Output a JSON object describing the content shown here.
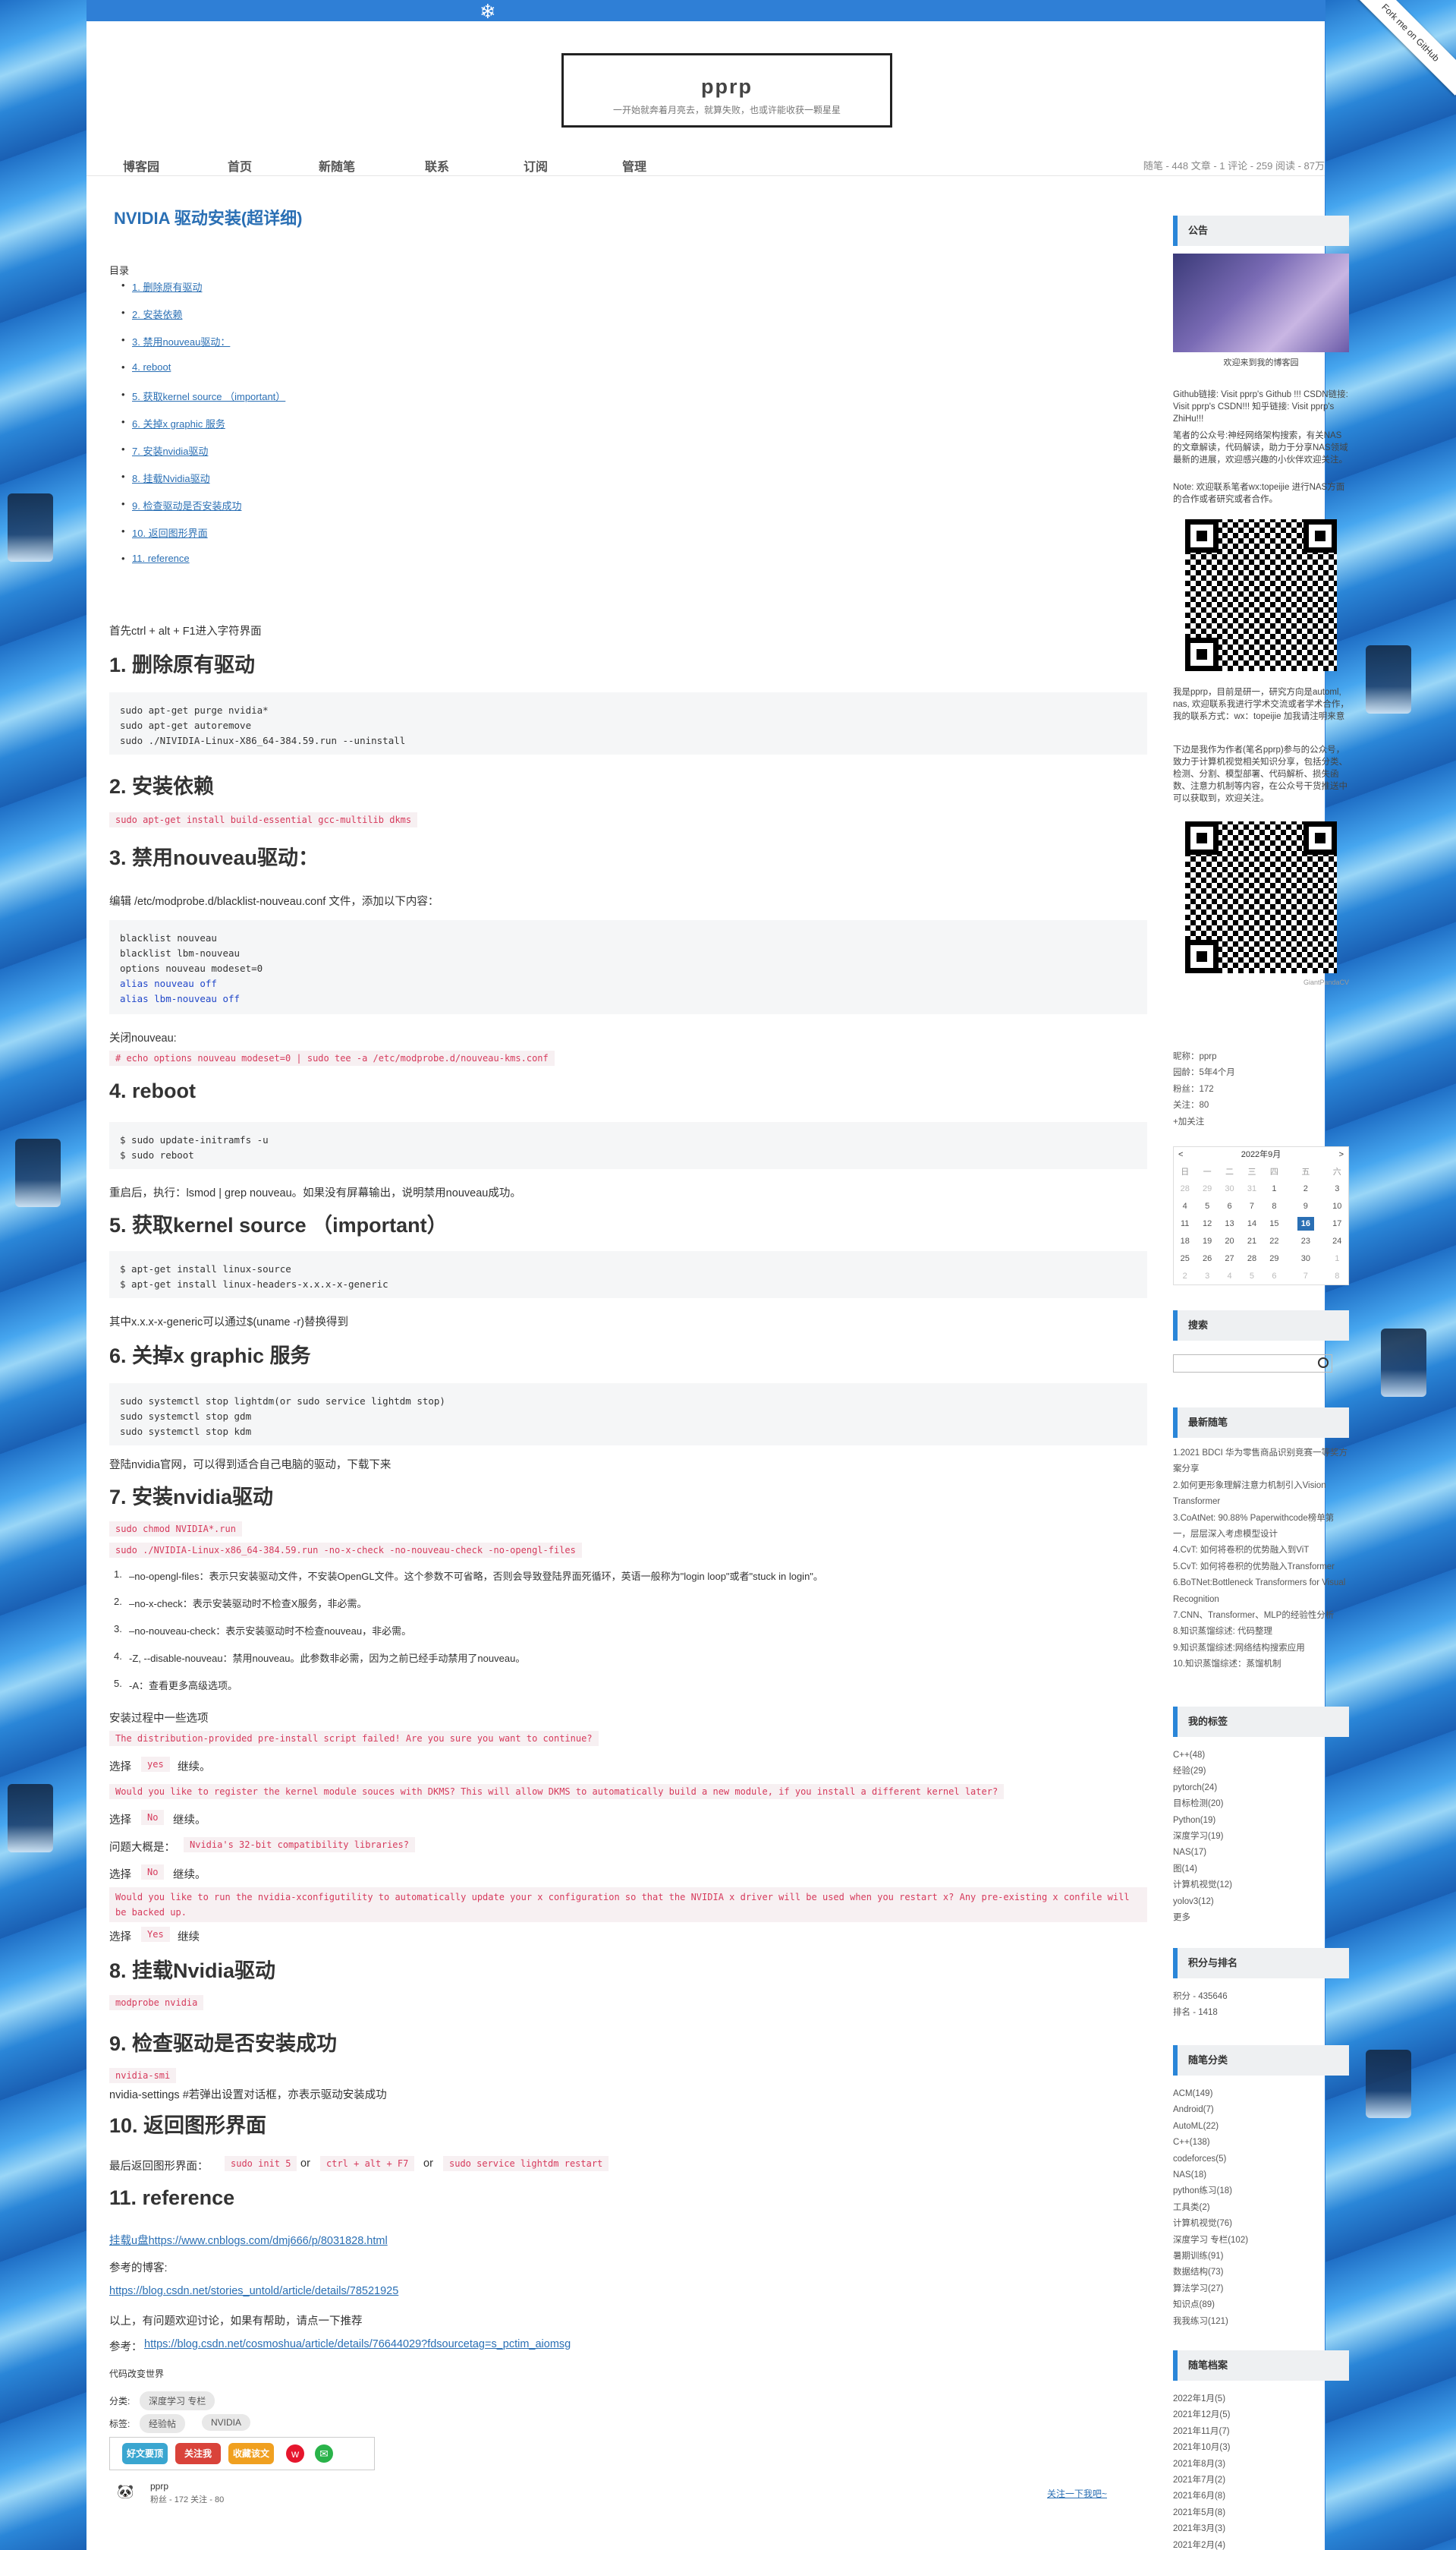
{
  "ribbon": "Fork me on GitHub",
  "header": {
    "title": "pprp",
    "subtitle": "一开始就奔着月亮去，就算失败，也或许能收获一颗星星"
  },
  "nav": [
    "博客园",
    "首页",
    "新随笔",
    "联系",
    "订阅",
    "管理"
  ],
  "blog_stats": "随笔 - 448  文章 - 1  评论 - 259  阅读 - 87万",
  "post": {
    "title": "NVIDIA 驱动安装(超详细)",
    "toc_label": "目录",
    "toc": [
      "1. 删除原有驱动",
      "2. 安装依赖",
      "3. 禁用nouveau驱动：",
      "4. reboot",
      "5. 获取kernel source （important）",
      "6. 关掉x graphic 服务",
      "7. 安装nvidia驱动",
      "8. 挂载Nvidia驱动",
      "9. 检查驱动是否安装成功",
      "10. 返回图形界面",
      "11. reference"
    ],
    "intro": "首先ctrl + alt + F1进入字符界面",
    "s1": {
      "title": "1. 删除原有驱动",
      "code": [
        "sudo apt-get purge nvidia*",
        "sudo apt-get autoremove",
        "sudo ./NIVIDIA-Linux-X86_64-384.59.run --uninstall"
      ]
    },
    "s2": {
      "title": "2. 安装依赖",
      "inline": "sudo apt-get install build-essential gcc-multilib dkms"
    },
    "s3": {
      "title": "3. 禁用nouveau驱动：",
      "text": "编辑 /etc/modprobe.d/blacklist-nouveau.conf 文件，添加以下内容：",
      "code": [
        "blacklist nouveau",
        "blacklist lbm-nouveau",
        "options nouveau modeset=0",
        "alias nouveau off",
        "alias lbm-nouveau off"
      ],
      "close_label": "关闭nouveau:",
      "inline": "# echo options nouveau modeset=0 | sudo tee -a /etc/modprobe.d/nouveau-kms.conf"
    },
    "s4": {
      "title": "4. reboot",
      "code": [
        "$ sudo update-initramfs -u",
        "$ sudo reboot"
      ],
      "text": "重启后，执行：lsmod | grep nouveau。如果没有屏幕输出，说明禁用nouveau成功。"
    },
    "s5": {
      "title": "5. 获取kernel source （important）",
      "code": [
        "$ apt-get install linux-source",
        "$ apt-get install linux-headers-x.x.x-x-generic"
      ],
      "text": "其中x.x.x-x-generic可以通过$(uname -r)替换得到"
    },
    "s6": {
      "title": "6. 关掉x graphic 服务",
      "code": [
        "sudo systemctl stop lightdm(or sudo service lightdm stop)",
        "sudo systemctl stop gdm",
        "sudo systemctl stop kdm"
      ],
      "text": "登陆nvidia官网，可以得到适合自己电脑的驱动，下载下来"
    },
    "s7": {
      "title": "7. 安装nvidia驱动",
      "inline1": "sudo chmod NVIDIA*.run",
      "inline2": "sudo ./NVIDIA-Linux-x86_64-384.59.run -no-x-check -no-nouveau-check -no-opengl-files",
      "options": [
        "–no-opengl-files：表示只安装驱动文件，不安装OpenGL文件。这个参数不可省略，否则会导致登陆界面死循环，英语一般称为\"login loop\"或者\"stuck in login\"。",
        "–no-x-check：表示安装驱动时不检查X服务，非必需。",
        "–no-nouveau-check：表示安装驱动时不检查nouveau，非必需。",
        "-Z, --disable-nouveau：禁用nouveau。此参数非必需，因为之前已经手动禁用了nouveau。",
        "-A：查看更多高级选项。"
      ],
      "process_label": "安装过程中一些选项",
      "q1": "The distribution-provided pre-install script failed! Are you sure you want to continue?",
      "choose": "选择",
      "continue": "继续。",
      "a1": "yes",
      "q2": "Would you like to register the kernel module souces with DKMS? This will allow DKMS to automatically build a new module, if you install a different kernel later?",
      "a2": "No",
      "q3_label": "问题大概是：",
      "q3": "Nvidia's 32-bit compatibility libraries?",
      "a3": "No",
      "q4": "Would you like to run the nvidia-xconfigutility to automatically update your x configuration so that the NVIDIA x driver will be used when you restart x? Any pre-existing x confile will be backed up.",
      "a4": "Yes",
      "continue2": "继续"
    },
    "s8": {
      "title": "8. 挂载Nvidia驱动",
      "inline": "modprobe nvidia"
    },
    "s9": {
      "title": "9. 检查驱动是否安装成功",
      "inline": "nvidia-smi",
      "text": "nvidia-settings #若弹出设置对话框，亦表示驱动安装成功"
    },
    "s10": {
      "title": "10. 返回图形界面",
      "label": "最后返回图形界面：",
      "c1": "sudo init 5",
      "or": "or",
      "c2": "ctrl + alt + F7",
      "c3": "sudo service lightdm restart"
    },
    "s11": {
      "title": "11. reference",
      "link1": "挂载u盘https://www.cnblogs.com/dmj666/p/8031828.html",
      "ref_label": "参考的博客:",
      "link2": "https://blog.csdn.net/stories_untold/article/details/78521925",
      "thanks": "以上，有问题欢迎讨论，如果有帮助，请点一下推荐",
      "ref2_label": "参考：",
      "link3": "https://blog.csdn.net/cosmoshua/article/details/76644029?fdsourcetag=s_pctim_aiomsg"
    },
    "signature": "代码改变世界",
    "category_label": "分类:",
    "category": "深度学习 专栏",
    "tags_label": "标签:",
    "tags": [
      "经验帖",
      "NVIDIA"
    ],
    "share": [
      "好文要顶",
      "关注我",
      "收藏该文"
    ],
    "author_name": "pprp",
    "author_stats": "粉丝 - 172  关注 - 80",
    "follow_link": "关注一下我吧~"
  },
  "sidebar": {
    "notice_title": "公告",
    "welcome": "欢迎来到我的博客园",
    "links_text": "Github链接: Visit pprp's Github !!! CSDN链接: Visit pprp's CSDN!!! 知乎链接: Visit pprp's ZhiHu!!!",
    "gzh_text": "笔者的公众号:神经网络架构搜索，有关NAS的文章解读，代码解读，助力于分享NAS领域最新的进展，欢迎感兴趣的小伙伴欢迎关注。",
    "note": "Note: 欢迎联系笔者wx:topeijie 进行NAS方面的合作或者研究或者合作。",
    "self_intro": "我是pprp，目前是研一，研究方向是automl, nas, 欢迎联系我进行学术交流或者学术合作，我的联系方式：wx：topeijie 加我请注明来意",
    "gdut_text": "下边是我作为作者(笔名pprp)参与的公众号，致力于计算机视觉相关知识分享，包括分类、检测、分割、模型部署、代码解析、损失函数、注意力机制等内容，在公众号干货推送中可以获取到，欢迎关注。",
    "qr_caption": "GiantPandaCV",
    "profile": [
      "昵称：pprp",
      "园龄：5年4个月",
      "粉丝：172",
      "关注：80",
      "+加关注"
    ],
    "calendar": {
      "title": "2022年9月",
      "prev": "<",
      "next": ">",
      "weekdays": [
        "日",
        "一",
        "二",
        "三",
        "四",
        "五",
        "六"
      ],
      "rows": [
        [
          "28",
          "29",
          "30",
          "31",
          "1",
          "2",
          "3"
        ],
        [
          "4",
          "5",
          "6",
          "7",
          "8",
          "9",
          "10"
        ],
        [
          "11",
          "12",
          "13",
          "14",
          "15",
          "16",
          "17"
        ],
        [
          "18",
          "19",
          "20",
          "21",
          "22",
          "23",
          "24"
        ],
        [
          "25",
          "26",
          "27",
          "28",
          "29",
          "30",
          "1"
        ],
        [
          "2",
          "3",
          "4",
          "5",
          "6",
          "7",
          "8"
        ]
      ],
      "today": "16"
    },
    "search_title": "搜索",
    "recent_title": "最新随笔",
    "recent": [
      "1.2021 BDCI 华为零售商品识别竞赛一等奖方案分享",
      "2.如何更形象理解注意力机制引入Vision Transformer",
      "3.CoAtNet: 90.88% Paperwithcode榜单第一，层层深入考虑模型设计",
      "4.CvT: 如何将卷积的优势融入到ViT",
      "5.CvT: 如何将卷积的优势融入Transformer",
      "6.BoTNet:Bottleneck Transformers for Visual Recognition",
      "7.CNN、Transformer、MLP的经验性分析",
      "8.知识蒸馏综述: 代码整理",
      "9.知识蒸馏综述:网络结构搜索应用",
      "10.知识蒸馏综述：蒸馏机制"
    ],
    "tags_title": "我的标签",
    "tags": [
      "C++(48)",
      "经验(29)",
      "pytorch(24)",
      "目标检测(20)",
      "Python(19)",
      "深度学习(19)",
      "NAS(17)",
      "图(14)",
      "计算机视觉(12)",
      "yolov3(12)",
      "更多"
    ],
    "rank_title": "积分与排名",
    "rank": [
      "积分 - 435646",
      "排名 - 1418"
    ],
    "cat_title": "随笔分类",
    "cats": [
      "ACM(149)",
      "Android(7)",
      "AutoML(22)",
      "C++(138)",
      "codeforces(5)",
      "NAS(18)",
      "python练习(18)",
      "工具类(2)",
      "计算机视觉(76)",
      "深度学习 专栏(102)",
      "暑期训练(91)",
      "数据结构(73)",
      "算法学习(27)",
      "知识点(89)",
      "我我练习(121)"
    ],
    "archive_title": "随笔档案",
    "archive": [
      "2022年1月(5)",
      "2021年12月(5)",
      "2021年11月(7)",
      "2021年10月(3)",
      "2021年8月(3)",
      "2021年7月(2)",
      "2021年6月(8)",
      "2021年5月(8)",
      "2021年3月(3)",
      "2021年2月(4)"
    ]
  }
}
